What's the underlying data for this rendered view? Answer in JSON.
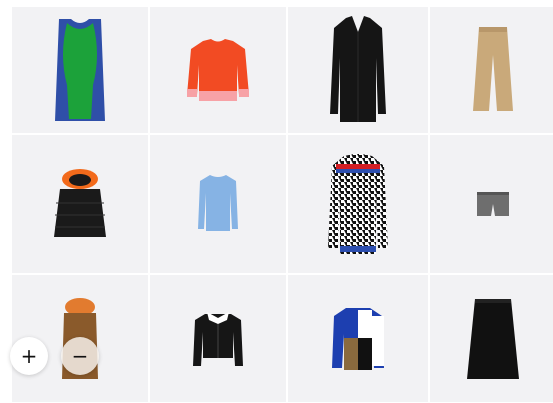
{
  "products": [
    {
      "item": "colorblock-knit-dress",
      "colors": [
        "#2f4fa8",
        "#1ca23a"
      ]
    },
    {
      "item": "red-orange-knit-sweater",
      "colors": [
        "#f24b23",
        "#f7a2a6"
      ]
    },
    {
      "item": "black-long-coat",
      "colors": [
        "#151515"
      ]
    },
    {
      "item": "beige-wide-trousers",
      "colors": [
        "#c9a97a"
      ]
    },
    {
      "item": "black-puffer-vest-orange-hood",
      "colors": [
        "#1a1a1a",
        "#f26a1b"
      ]
    },
    {
      "item": "light-blue-knit-top",
      "colors": [
        "#86b3e4"
      ]
    },
    {
      "item": "houndstooth-coat",
      "colors": [
        "#ffffff",
        "#111111",
        "#d41e24",
        "#2d4fb0"
      ]
    },
    {
      "item": "grey-tweed-shorts",
      "colors": [
        "#6e6e6e"
      ]
    },
    {
      "item": "brown-orange-hooded-top",
      "colors": [
        "#8a5a2b",
        "#e27b2f"
      ]
    },
    {
      "item": "black-cropped-jacket-white-collar",
      "colors": [
        "#161616",
        "#ffffff"
      ]
    },
    {
      "item": "colorblock-sweater",
      "colors": [
        "#1d3fb0",
        "#ffffff",
        "#8a6a3e",
        "#111111"
      ]
    },
    {
      "item": "black-midi-skirt",
      "colors": [
        "#111111"
      ]
    }
  ],
  "controls": {
    "zoom_in_symbol": "+",
    "zoom_out_symbol": "−"
  }
}
